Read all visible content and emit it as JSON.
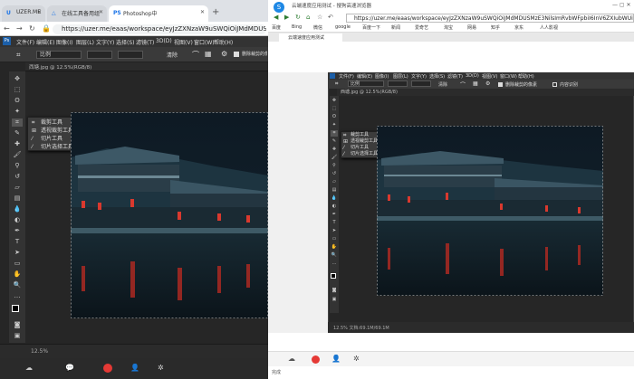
{
  "left_browser": {
    "tabs": [
      {
        "label": "UZER.ME",
        "favicon": "U"
      },
      {
        "label": "在线工具备用组",
        "favicon": "△"
      },
      {
        "label": "Photoshop中",
        "favicon": "PS"
      }
    ],
    "new_tab_symbol": "+",
    "url": "https://uzer.me/eaas/workspace/eyJzZXNzaW9uSWQiOiJMdMDUSMzE3N",
    "menus": [
      "文件(F)",
      "编辑(E)",
      "图像(I)",
      "图层(L)",
      "文字(Y)",
      "选择(S)",
      "滤镜(T)",
      "3D(D)",
      "视图(V)",
      "窗口(W)",
      "帮助(H)"
    ],
    "options_ratio": "比例",
    "options_extra": [
      "清除",
      "拉直",
      "删除裁剪的像素"
    ],
    "doc_tab": "西塘.jpg @ 12.5%(RGB/8)",
    "flyout": [
      {
        "label": "裁剪工具",
        "key": "C"
      },
      {
        "label": "透视裁剪工具",
        "key": "C"
      },
      {
        "label": "切片工具",
        "key": "C"
      },
      {
        "label": "切片选择工具",
        "key": "C"
      }
    ],
    "status": "12.5%"
  },
  "right_browser": {
    "title": "云端速度应用测试 - 搜狗高速浏览器",
    "url": "https://uzer.me/eaas/workspace/eyJzZXNzaW9uSWQiOiJMdMDUSMzE3NilsImRvbWFpbiI6InV6ZXIubWUifQ",
    "bookmarks": [
      "百度",
      "Bing",
      "微信",
      "google",
      "百度一下",
      "新闻",
      "爱奇艺",
      "淘宝",
      "网易",
      "知乎",
      "京东",
      "人人影视"
    ],
    "tab_label": "云端速度应用测试",
    "menus": [
      "文件(F)",
      "编辑(E)",
      "图像(I)",
      "图层(L)",
      "文字(Y)",
      "选择(S)",
      "滤镜(T)",
      "3D(D)",
      "视图(V)",
      "窗口(W)",
      "帮助(H)"
    ],
    "options_ratio": "比例",
    "options_extra": [
      "清除",
      "拉直",
      "删除裁剪的像素",
      "内容识别"
    ],
    "doc_tab": "西塘.jpg @ 12.5%(RGB/8)",
    "flyout": [
      {
        "label": "裁剪工具",
        "key": "C"
      },
      {
        "label": "透视裁剪工具",
        "key": "C"
      },
      {
        "label": "切片工具",
        "key": "C"
      },
      {
        "label": "切片选择工具",
        "key": "C"
      }
    ],
    "status": "12.5%   文档:69.1M/69.1M",
    "footer": "完成"
  },
  "colors": {
    "ps_bg": "#262626",
    "ps_panel": "#333333",
    "chrome_tab": "#dee1e6",
    "record": "#e53935"
  },
  "icons": [
    "crop-icon",
    "move-icon",
    "marquee-icon",
    "lasso-icon",
    "brush-icon",
    "eraser-icon",
    "text-icon",
    "hand-icon",
    "zoom-icon",
    "cloud-icon",
    "chat-icon",
    "record-icon",
    "user-icon",
    "settings-icon"
  ]
}
